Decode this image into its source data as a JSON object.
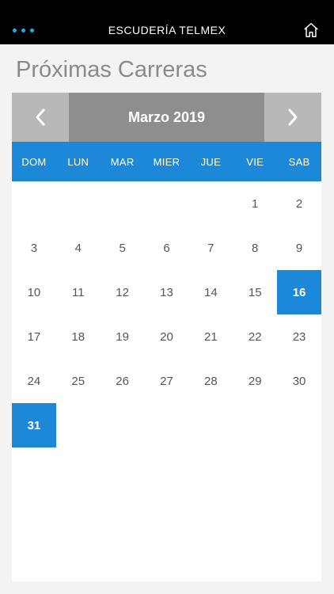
{
  "header": {
    "app_title": "ESCUDERÍA TELMEX"
  },
  "page": {
    "title": "Próximas Carreras"
  },
  "calendar": {
    "month_label": "Marzo 2019",
    "weekdays": [
      "DOM",
      "LUN",
      "MAR",
      "MIER",
      "JUE",
      "VIE",
      "SAB"
    ],
    "leading_blanks": 5,
    "days": [
      "1",
      "2",
      "3",
      "4",
      "5",
      "6",
      "7",
      "8",
      "9",
      "10",
      "11",
      "12",
      "13",
      "14",
      "15",
      "16",
      "17",
      "18",
      "19",
      "20",
      "21",
      "22",
      "23",
      "24",
      "25",
      "26",
      "27",
      "28",
      "29",
      "30",
      "31"
    ],
    "highlighted_days": [
      "16",
      "31"
    ],
    "colors": {
      "accent": "#1e88d8",
      "nav_button": "#b8b8b8",
      "month_bar": "#8e8e8e"
    }
  },
  "icons": {
    "menu": "menu-dots-icon",
    "home": "home-icon",
    "prev": "chevron-left-icon",
    "next": "chevron-right-icon"
  }
}
